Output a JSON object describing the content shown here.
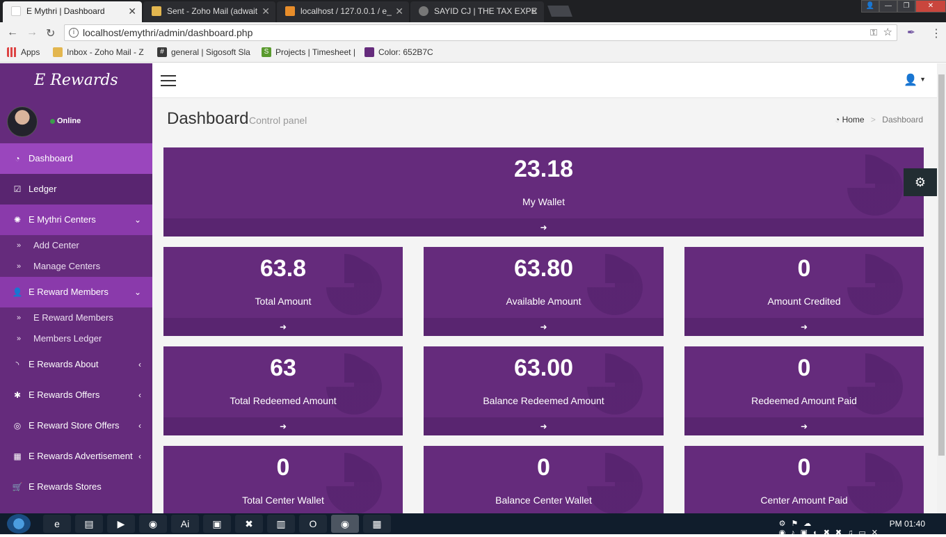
{
  "browser": {
    "tabs": [
      {
        "title": "E Mythri | Dashboard",
        "active": true
      },
      {
        "title": "Sent - Zoho Mail (adwait",
        "active": false
      },
      {
        "title": "localhost / 127.0.0.1 / e_",
        "active": false
      },
      {
        "title": "SAYID CJ | THE TAX EXPE",
        "active": false
      }
    ],
    "address": "localhost/emythri/admin/dashboard.php",
    "bookmarks": [
      "Apps",
      "Inbox - Zoho Mail - Z",
      "general | Sigosoft Sla",
      "Projects | Timesheet |",
      "Color: 652B7C"
    ]
  },
  "sidebar": {
    "logo": "E Rewards",
    "status": "Online",
    "items": [
      {
        "label": "Dashboard",
        "icon": "dashboard-icon"
      },
      {
        "label": "Ledger",
        "icon": "check-square-icon"
      },
      {
        "label": "E Mythri Centers",
        "icon": "certificate-icon"
      },
      {
        "label": "Add Center"
      },
      {
        "label": "Manage Centers"
      },
      {
        "label": "E Reward Members",
        "icon": "user-icon"
      },
      {
        "label": "E Reward Members"
      },
      {
        "label": "Members Ledger"
      },
      {
        "label": "E Rewards About",
        "icon": "rss-icon"
      },
      {
        "label": "E Rewards Offers",
        "icon": "asterisk-icon"
      },
      {
        "label": "E Reward Store Offers",
        "icon": "bullseye-icon"
      },
      {
        "label": "E Rewards Advertisement",
        "icon": "film-icon"
      },
      {
        "label": "E Rewards Stores",
        "icon": "cart-icon"
      }
    ]
  },
  "header": {
    "title": "Dashboard",
    "subtitle": "Control panel",
    "breadcrumb_home": "Home",
    "breadcrumb_current": "Dashboard"
  },
  "boxes": {
    "wallet": {
      "value": "23.18",
      "label": "My Wallet"
    },
    "total_amount": {
      "value": "63.8",
      "label": "Total Amount"
    },
    "available_amount": {
      "value": "63.80",
      "label": "Available Amount"
    },
    "amount_credited": {
      "value": "0",
      "label": "Amount Credited"
    },
    "total_redeemed": {
      "value": "63",
      "label": "Total Redeemed Amount"
    },
    "balance_redeemed": {
      "value": "63.00",
      "label": "Balance Redeemed Amount"
    },
    "redeemed_paid": {
      "value": "0",
      "label": "Redeemed Amount Paid"
    },
    "total_center_wallet": {
      "value": "0",
      "label": "Total Center Wallet"
    },
    "balance_center_wallet": {
      "value": "0",
      "label": "Balance Center Wallet"
    },
    "center_amount_paid": {
      "value": "0",
      "label": "Center Amount Paid"
    }
  },
  "taskbar": {
    "clock": "PM 01:40"
  },
  "colors": {
    "brand": "#652b7c",
    "active": "#9a46bd"
  }
}
